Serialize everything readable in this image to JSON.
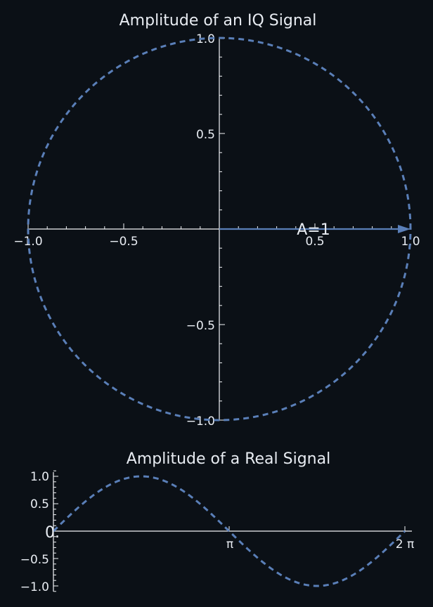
{
  "colors": {
    "background": "#0b1016",
    "axis": "#f2f4f7",
    "text": "#e8ecf2",
    "series": "#5a7fb8"
  },
  "chart_data": [
    {
      "type": "line",
      "title": "Amplitude of an IQ Signal",
      "xlabel": "",
      "ylabel": "",
      "xlim": [
        -1.0,
        1.0
      ],
      "ylim": [
        -1.0,
        1.0
      ],
      "x_ticks": [
        {
          "value": -1.0,
          "label": "−1.0"
        },
        {
          "value": -0.5,
          "label": "−0.5"
        },
        {
          "value": 0.5,
          "label": "0.5"
        },
        {
          "value": 1.0,
          "label": "1.0"
        }
      ],
      "y_ticks": [
        {
          "value": 1.0,
          "label": "1.0"
        },
        {
          "value": 0.5,
          "label": "0.5"
        },
        {
          "value": -0.5,
          "label": "−0.5"
        },
        {
          "value": -1.0,
          "label": "−1.0"
        }
      ],
      "series": [
        {
          "style": "dashed",
          "curve": "unit circle x = cos(t), y = sin(t)",
          "t_range": [
            0,
            6.2832
          ]
        }
      ],
      "arrow": {
        "from": [
          0,
          0
        ],
        "to": [
          1,
          0
        ]
      },
      "annotations": [
        {
          "text": "A=1",
          "x": 0.5,
          "y": 0
        }
      ],
      "grid": false
    },
    {
      "type": "line",
      "title": "Amplitude of a Real Signal",
      "xlabel": "",
      "ylabel": "",
      "xlim": [
        0,
        6.2832
      ],
      "ylim": [
        -1.0,
        1.0
      ],
      "x_ticks": [
        {
          "value": 3.1416,
          "label": "π"
        },
        {
          "value": 6.2832,
          "label": "2 π"
        }
      ],
      "y_ticks": [
        {
          "value": 1.0,
          "label": "1.0"
        },
        {
          "value": 0.5,
          "label": "0.5"
        },
        {
          "value": -0.5,
          "label": "−0.5"
        },
        {
          "value": -1.0,
          "label": "−1.0"
        }
      ],
      "series": [
        {
          "style": "dashed",
          "curve": "y = sin(x)",
          "x_range": [
            0,
            6.2832
          ]
        }
      ],
      "annotations": [
        {
          "text": "0.",
          "x": 0,
          "y": 0
        }
      ],
      "grid": false
    }
  ]
}
